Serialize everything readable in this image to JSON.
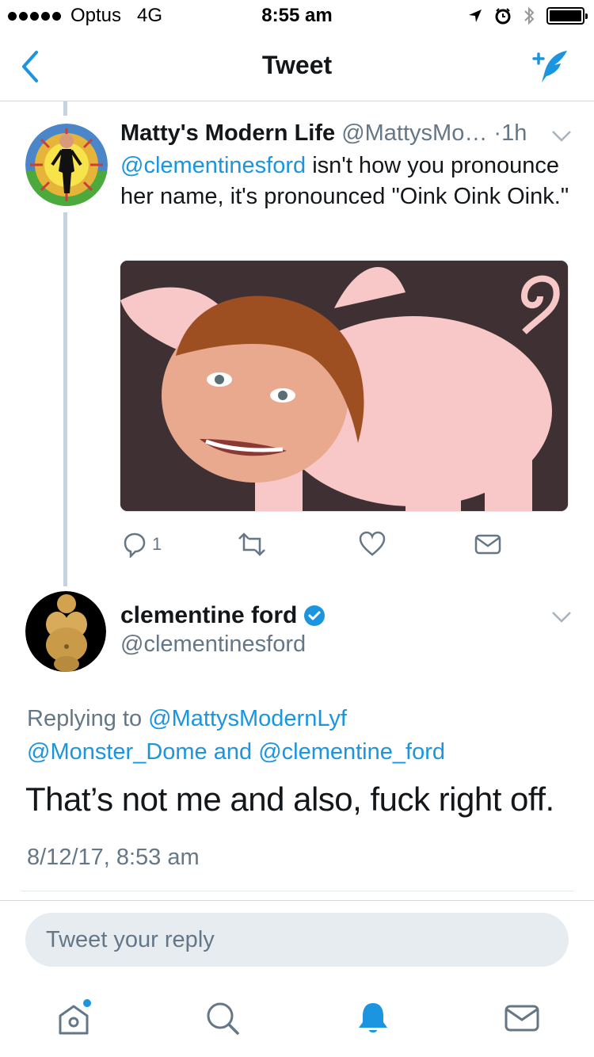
{
  "status_bar": {
    "carrier": "Optus",
    "network": "4G",
    "time": "8:55 am"
  },
  "nav": {
    "title": "Tweet",
    "back_icon": "chevron-left-icon",
    "compose_icon": "compose-tweet-icon"
  },
  "parent_tweet": {
    "name": "Matty's Modern Life",
    "handle": "@MattysMo…",
    "separator": "·",
    "age": "1h",
    "mention": "@clementinesford",
    "text": " isn't how you pronounce her name, it's pronounced \"Oink Oink Oink.\"",
    "reply_count": "1"
  },
  "main_tweet": {
    "name": "clementine ford",
    "handle": "@clementinesford",
    "replying_prefix": "Replying to",
    "replying_to_1": "@MattysModernLyf",
    "replying_to_2": "@Monster_Dome",
    "replying_and": "and",
    "replying_to_3": "@clementine_ford",
    "text": "That’s not me and also, fuck right off.",
    "timestamp": "8/12/17, 8:53 am"
  },
  "reply_input": {
    "placeholder": "Tweet your reply"
  },
  "colors": {
    "accent": "#1b95e0",
    "muted": "#657786",
    "thread_line": "#c8d2da"
  }
}
